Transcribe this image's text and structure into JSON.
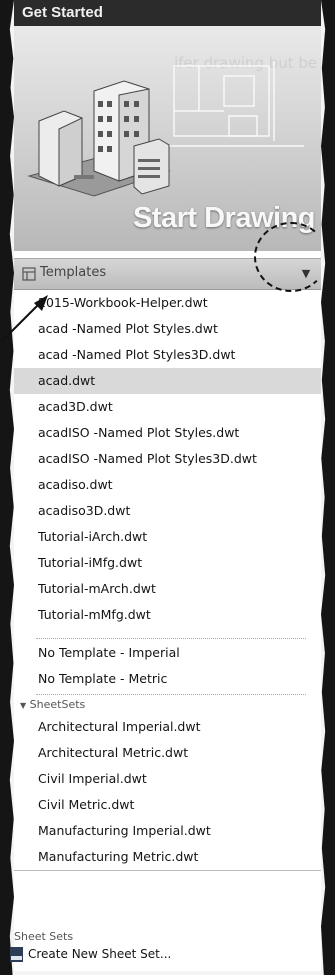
{
  "header": {
    "title": "Get Started"
  },
  "hero": {
    "title": "Start Drawing",
    "ghost_text": "ifer drawing but be pa"
  },
  "templates": {
    "label": "Templates",
    "dropdown_icon": "triangle-down-icon",
    "items": [
      "2015-Workbook-Helper.dwt",
      "acad -Named Plot Styles.dwt",
      "acad -Named Plot Styles3D.dwt",
      "acad.dwt",
      "acad3D.dwt",
      "acadISO -Named Plot Styles.dwt",
      "acadISO -Named Plot Styles3D.dwt",
      "acadiso.dwt",
      "acadiso3D.dwt",
      "Tutorial-iArch.dwt",
      "Tutorial-iMfg.dwt",
      "Tutorial-mArch.dwt",
      "Tutorial-mMfg.dwt"
    ],
    "selected_index": 3,
    "no_template_items": [
      "No Template - Imperial",
      "No Template - Metric"
    ]
  },
  "sheetsets": {
    "label": "SheetSets",
    "items": [
      "Architectural Imperial.dwt",
      "Architectural Metric.dwt",
      "Civil Imperial.dwt",
      "Civil Metric.dwt",
      "Manufacturing Imperial.dwt",
      "Manufacturing Metric.dwt"
    ]
  },
  "sheet_sets_section": {
    "title": "Sheet Sets",
    "create_label": "Create New Sheet Set..."
  }
}
